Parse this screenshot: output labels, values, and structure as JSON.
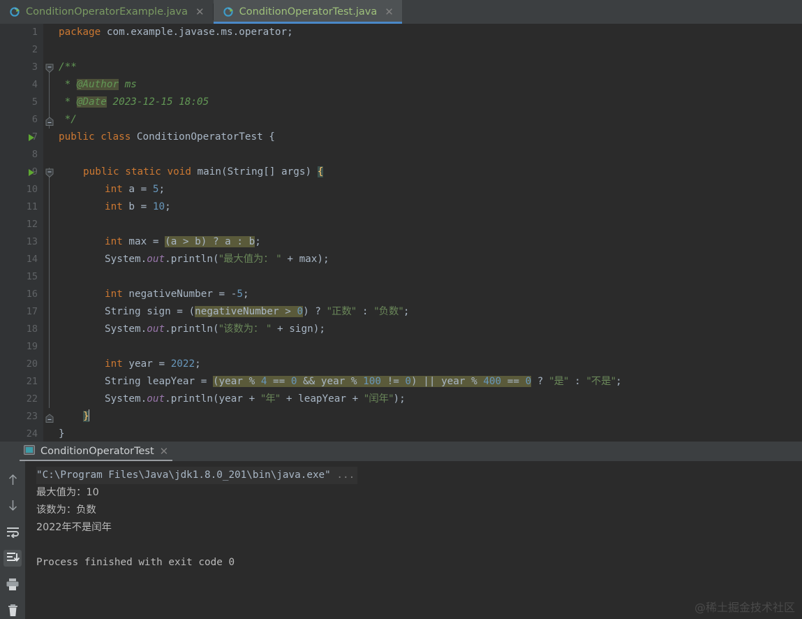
{
  "editor_tabs": [
    {
      "label": "ConditionOperatorExample.java",
      "icon": "java-class-icon",
      "close_icon": "close-icon",
      "active": false
    },
    {
      "label": "ConditionOperatorTest.java",
      "icon": "java-class-icon",
      "close_icon": "close-icon",
      "active": true
    }
  ],
  "code": {
    "line_numbers": [
      "1",
      "2",
      "3",
      "4",
      "5",
      "6",
      "7",
      "8",
      "9",
      "10",
      "11",
      "12",
      "13",
      "14",
      "15",
      "16",
      "17",
      "18",
      "19",
      "20",
      "21",
      "22",
      "23",
      "24"
    ],
    "lines": {
      "l1_package_kw": "package",
      "l1_package_name": " com.example.javase.ms.operator;",
      "l3_doc_open": "/**",
      "l4_star": " * ",
      "l4_tag": "@Author",
      "l4_text": " ms",
      "l5_star": " * ",
      "l5_tag": "@Date",
      "l5_text": " 2023-12-15 18:05",
      "l6_doc_close": " */",
      "l7_public": "public",
      "l7_class": "class",
      "l7_name": " ConditionOperatorTest {",
      "l9_mods": "public static void",
      "l9_sig": " main(String[] args) ",
      "l9_brace": "{",
      "l10_kw": "int",
      "l10_mid": " a = ",
      "l10_num": "5",
      "l10_end": ";",
      "l11_kw": "int",
      "l11_mid": " b = ",
      "l11_num": "10",
      "l11_end": ";",
      "l13_kw": "int",
      "l13_mid": " max = ",
      "l13_hl": "(a > b) ? a : b",
      "l13_end": ";",
      "l14_pre": "System.",
      "l14_field": "out",
      "l14_call": ".println(",
      "l14_str": "\"最大值为： \"",
      "l14_post": " + max);",
      "l16_kw": "int",
      "l16_mid": " negativeNumber = -",
      "l16_num": "5",
      "l16_end": ";",
      "l17_pre": "String sign = (",
      "l17_hl_a": "negativeNumber > ",
      "l17_hl_num": "0",
      "l17_mid": ") ? ",
      "l17_str1": "\"正数\"",
      "l17_colon": " : ",
      "l17_str2": "\"负数\"",
      "l17_end": ";",
      "l18_pre": "System.",
      "l18_field": "out",
      "l18_call": ".println(",
      "l18_str": "\"该数为： \"",
      "l18_post": " + sign);",
      "l20_kw": "int",
      "l20_mid": " year = ",
      "l20_num": "2022",
      "l20_end": ";",
      "l21_pre": "String leapYear = ",
      "l21_h1": "(year % ",
      "l21_h2": "4",
      "l21_h3": " == ",
      "l21_h4": "0",
      "l21_h5": " && year % ",
      "l21_h6": "100",
      "l21_h7": " != ",
      "l21_h8": "0",
      "l21_h9": ") || year % ",
      "l21_h10": "400",
      "l21_h11": " == ",
      "l21_h12": "0",
      "l21_mid": " ? ",
      "l21_str1": "\"是\"",
      "l21_colon": " : ",
      "l21_str2": "\"不是\"",
      "l21_end": ";",
      "l22_pre": "System.",
      "l22_field": "out",
      "l22_call": ".println(year + ",
      "l22_str1": "\"年\"",
      "l22_mid": " + leapYear + ",
      "l22_str2": "\"闰年\"",
      "l22_end": ");",
      "l23_brace": "}",
      "l24_brace": "}"
    },
    "run_arrow_lines": [
      7,
      9
    ],
    "run_arrow_icon": "run-gutter-icon",
    "fold_icon": "code-fold-icon"
  },
  "console": {
    "tab_label": "ConditionOperatorTest",
    "tab_icon": "console-window-icon",
    "tab_close_icon": "close-icon",
    "toolbar": [
      {
        "name": "scroll-up-icon",
        "active": false
      },
      {
        "name": "scroll-down-icon",
        "active": false
      },
      {
        "name": "soft-wrap-icon",
        "active": false
      },
      {
        "name": "scroll-to-end-icon",
        "active": true
      },
      {
        "name": "print-icon",
        "active": false
      },
      {
        "name": "clear-all-icon",
        "active": false
      }
    ],
    "output": [
      "\"C:\\Program Files\\Java\\jdk1.8.0_201\\bin\\java.exe\" ",
      "最大值为：10",
      "该数为：负数",
      "2022年不是闰年",
      "",
      "Process finished with exit code 0"
    ],
    "output_ellipsis": "...",
    "watermark": "@稀土掘金技术社区"
  },
  "colors": {
    "editor_bg": "#2b2b2b",
    "gutter_bg": "#313335",
    "tabbar_bg": "#3c3f41",
    "active_tab_bg": "#4e5254",
    "active_tab_underline": "#4a88c7",
    "keyword": "#cc7832",
    "number": "#6897bb",
    "string": "#6a8759",
    "javadoc": "#629755",
    "field": "#9876aa",
    "default_text": "#a9b7c6",
    "highlight": "#5a5a3a",
    "tab_text": "#9ec07a"
  }
}
